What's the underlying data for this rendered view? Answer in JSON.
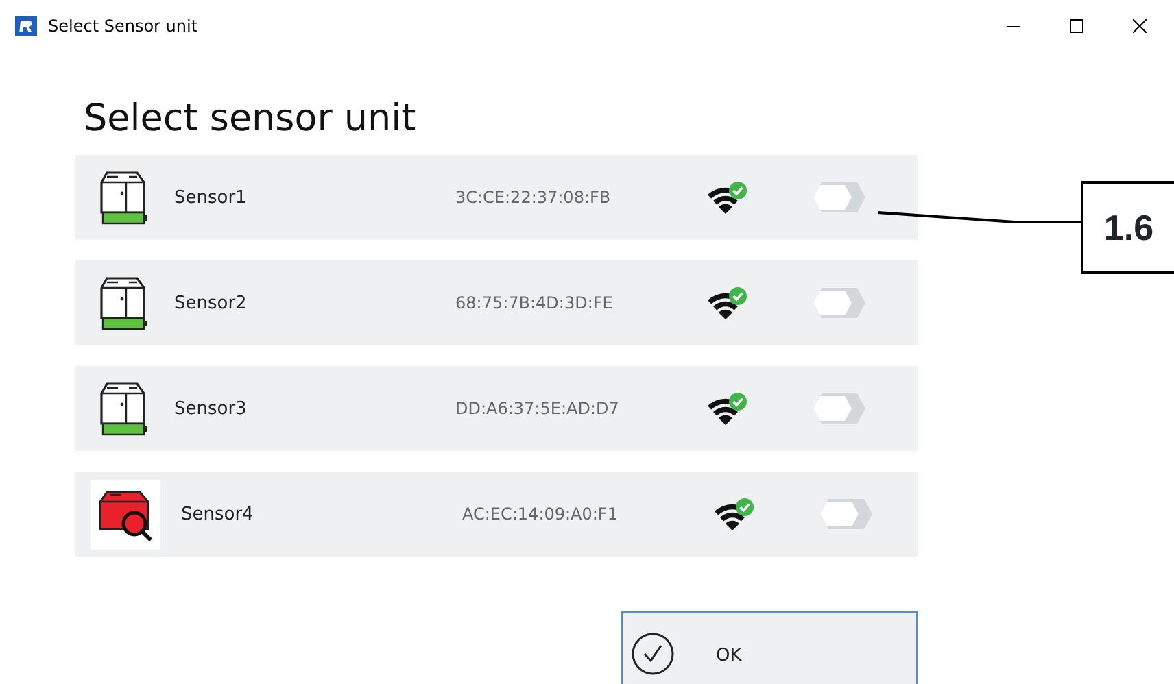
{
  "window": {
    "title": "Select Sensor unit"
  },
  "heading": "Select sensor unit",
  "sensors": [
    {
      "name": "Sensor1",
      "address": "3C:CE:22:37:08:FB",
      "kind": "battery",
      "on": false
    },
    {
      "name": "Sensor2",
      "address": "68:75:7B:4D:3D:FE",
      "kind": "battery",
      "on": false
    },
    {
      "name": "Sensor3",
      "address": "DD:A6:37:5E:AD:D7",
      "kind": "battery",
      "on": false
    },
    {
      "name": "Sensor4",
      "address": "AC:EC:14:09:A0:F1",
      "kind": "search",
      "on": false
    }
  ],
  "ok_button": "OK",
  "callout": "1.6"
}
